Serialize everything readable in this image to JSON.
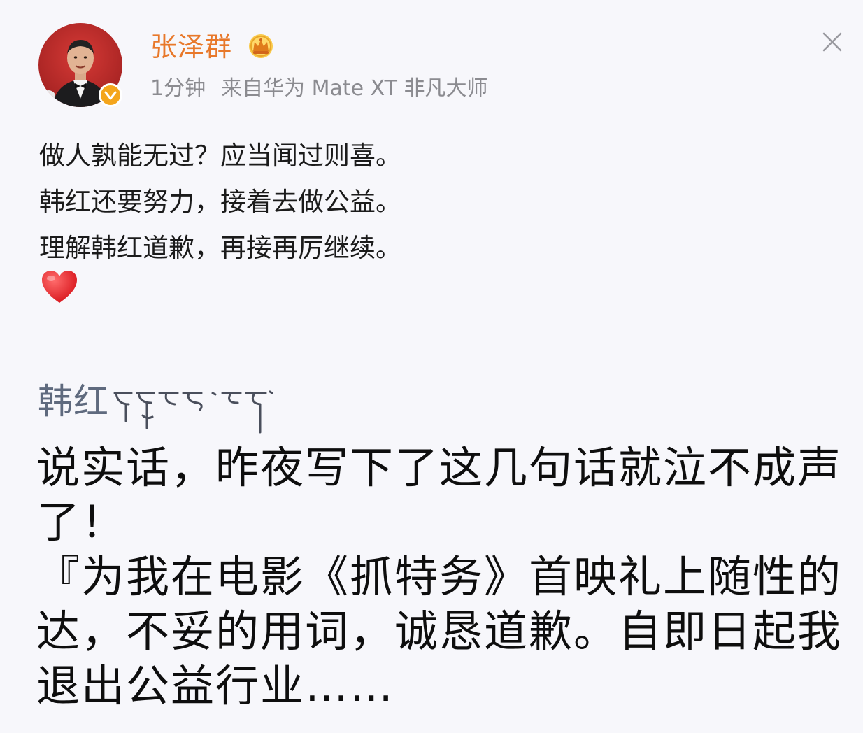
{
  "post": {
    "author": "张泽群",
    "time": "1分钟",
    "source": "来自华为 Mate XT 非凡大师",
    "lines": [
      "做人孰能无过？应当闻过则喜。",
      "韩红还要努力，接着去做公益。",
      "理解韩红道歉，再接再厉继续。"
    ],
    "icons": {
      "avatar": "avatar",
      "verified": "verified-badge-icon",
      "vip": "crown-icon",
      "close": "close-icon",
      "emoji": "red-heart-emoji"
    }
  },
  "quoted": {
    "signature": "韩红",
    "signature_script": "tibetan-script",
    "lines": [
      "说实话，昨夜写下了这几句话就泣不成声",
      "了！",
      "『为我在电影《抓特务》首映礼上随性的",
      "达，不妥的用词，诚恳道歉。自即日起我",
      "退出公益行业……"
    ]
  },
  "colors": {
    "author_name": "#e8782a",
    "meta_text": "#8b8b90",
    "verified": "#f4a51c",
    "background": "#f7f7fb"
  }
}
